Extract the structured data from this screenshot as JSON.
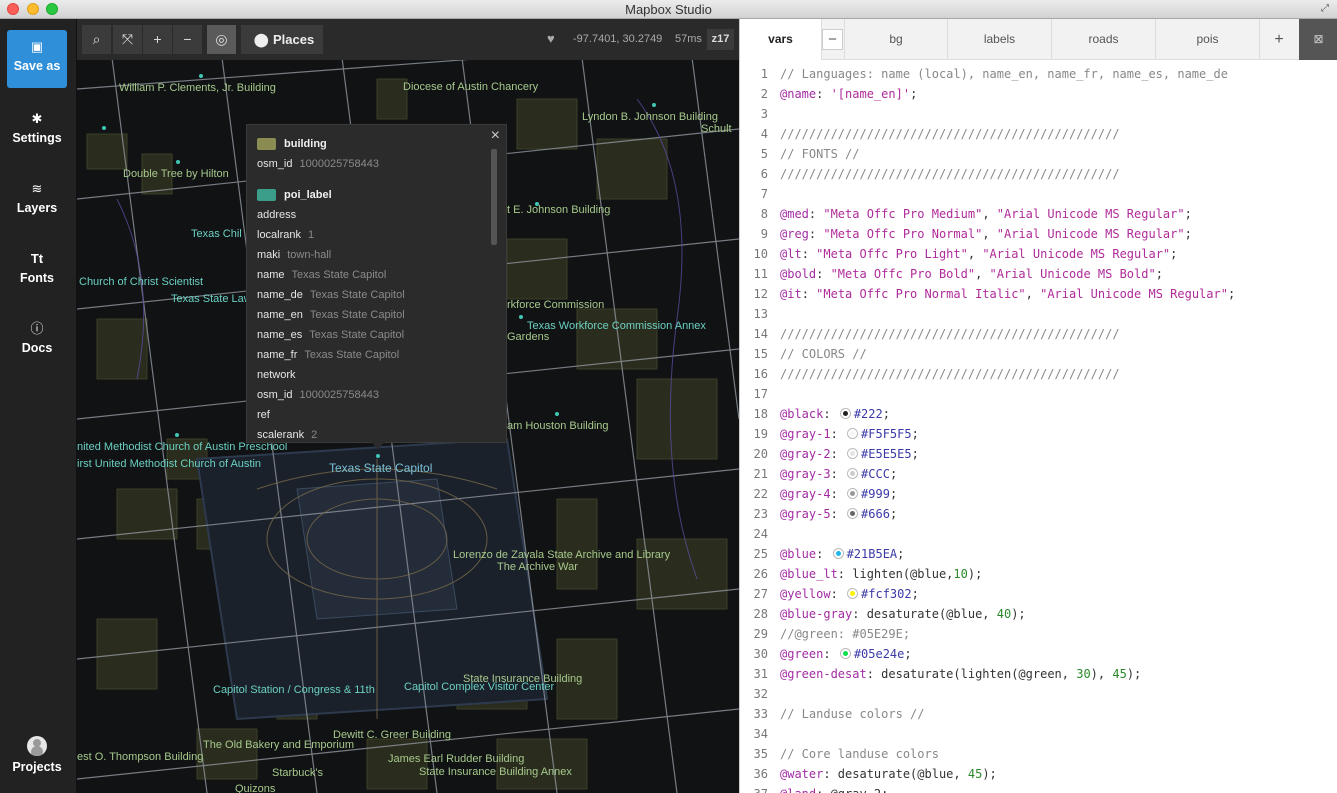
{
  "window": {
    "title": "Mapbox Studio"
  },
  "sidebar": {
    "save_as": "Save as",
    "settings": "Settings",
    "layers": "Layers",
    "fonts": "Fonts",
    "docs": "Docs",
    "projects": "Projects"
  },
  "map_toolbar": {
    "places": "Places",
    "coords": "-97.7401, 30.2749",
    "render_time": "57ms",
    "zoom": "z17"
  },
  "map_labels": [
    "William P. Clements, Jr. Building",
    "Diocese of Austin Chancery",
    "Lyndon B. Johnson Building",
    "Schult",
    "Double Tree by Hilton",
    "t E. Johnson Building",
    "Texas Chil",
    "Church of Christ Scientist",
    "Texas State Law",
    "rkforce Commission",
    "Texas Workforce Commission Annex",
    "Gardens",
    "am Houston Building",
    "nited Methodist Church of Austin Preschool",
    "irst United Methodist Church of Austin",
    "Texas State Capitol",
    "Lorenzo de Zavala State Archive and Library",
    "The Archive War",
    "State Insurance Building",
    "Capitol Station / Congress & 11th",
    "Capitol Complex Visitor Center",
    "Dewitt C. Greer Building",
    "The Old Bakery and Emporium",
    "est O. Thompson Building",
    "James Earl Rudder Building",
    "State Insurance Building Annex",
    "Starbuck's",
    "Quizons"
  ],
  "popup": {
    "layers": [
      {
        "name": "building",
        "color": "#8a8c52",
        "props": [
          {
            "key": "osm_id",
            "value": "1000025758443"
          }
        ]
      },
      {
        "name": "poi_label",
        "color": "#3a9e8a",
        "props": [
          {
            "key": "address",
            "value": ""
          },
          {
            "key": "localrank",
            "value": "1"
          },
          {
            "key": "maki",
            "value": "town-hall"
          },
          {
            "key": "name",
            "value": "Texas State Capitol"
          },
          {
            "key": "name_de",
            "value": "Texas State Capitol"
          },
          {
            "key": "name_en",
            "value": "Texas State Capitol"
          },
          {
            "key": "name_es",
            "value": "Texas State Capitol"
          },
          {
            "key": "name_fr",
            "value": "Texas State Capitol"
          },
          {
            "key": "network",
            "value": ""
          },
          {
            "key": "osm_id",
            "value": "1000025758443"
          },
          {
            "key": "ref",
            "value": ""
          },
          {
            "key": "scalerank",
            "value": "2"
          }
        ]
      }
    ]
  },
  "editor": {
    "tabs": [
      "vars",
      "bg",
      "labels",
      "roads",
      "pois"
    ],
    "active_tab": "vars",
    "lines": [
      "// Languages: name (local), name_en, name_fr, name_es, name_de",
      "@name: '[name_en]';",
      "",
      "///////////////////////////////////////////////",
      "// FONTS //",
      "///////////////////////////////////////////////",
      "",
      "@med: \"Meta Offc Pro Medium\", \"Arial Unicode MS Regular\";",
      "@reg: \"Meta Offc Pro Normal\", \"Arial Unicode MS Regular\";",
      "@lt: \"Meta Offc Pro Light\", \"Arial Unicode MS Regular\";",
      "@bold: \"Meta Offc Pro Bold\", \"Arial Unicode MS Bold\";",
      "@it: \"Meta Offc Pro Normal Italic\", \"Arial Unicode MS Regular\";",
      "",
      "///////////////////////////////////////////////",
      "// COLORS //",
      "///////////////////////////////////////////////",
      "",
      "@black: #222;",
      "@gray-1: #F5F5F5;",
      "@gray-2: #E5E5E5;",
      "@gray-3: #CCC;",
      "@gray-4: #999;",
      "@gray-5: #666;",
      "",
      "@blue: #21B5EA;",
      "@blue_lt: lighten(@blue,10);",
      "@yellow: #fcf302;",
      "@blue-gray: desaturate(@blue, 40);",
      "//@green: #05E29E;",
      "@green: #05e24e;",
      "@green-desat: desaturate(lighten(@green, 30), 45);",
      "",
      "// Landuse colors //",
      "",
      "// Core landuse colors",
      "@water: desaturate(@blue, 45);",
      "@land: @gray-2;"
    ],
    "swatches": {
      "18": "#222222",
      "19": "#F5F5F5",
      "20": "#E5E5E5",
      "21": "#CCCCCC",
      "22": "#999999",
      "23": "#666666",
      "25": "#21B5EA",
      "27": "#fcf302",
      "29": "#05E29E",
      "30": "#05e24e"
    }
  }
}
